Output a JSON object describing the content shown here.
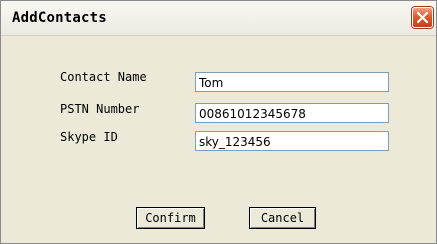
{
  "window": {
    "title": "AddContacts",
    "close_icon": "close-x-icon",
    "close_color": "#e2582c"
  },
  "form": {
    "contact_name": {
      "label": "Contact Name",
      "value": "Tom"
    },
    "pstn_number": {
      "label": "PSTN Number",
      "value": "00861012345678"
    },
    "skype_id": {
      "label": "Skype ID",
      "value": "sky_123456"
    }
  },
  "buttons": {
    "confirm_label": "Confirm",
    "cancel_label": "Cancel"
  }
}
